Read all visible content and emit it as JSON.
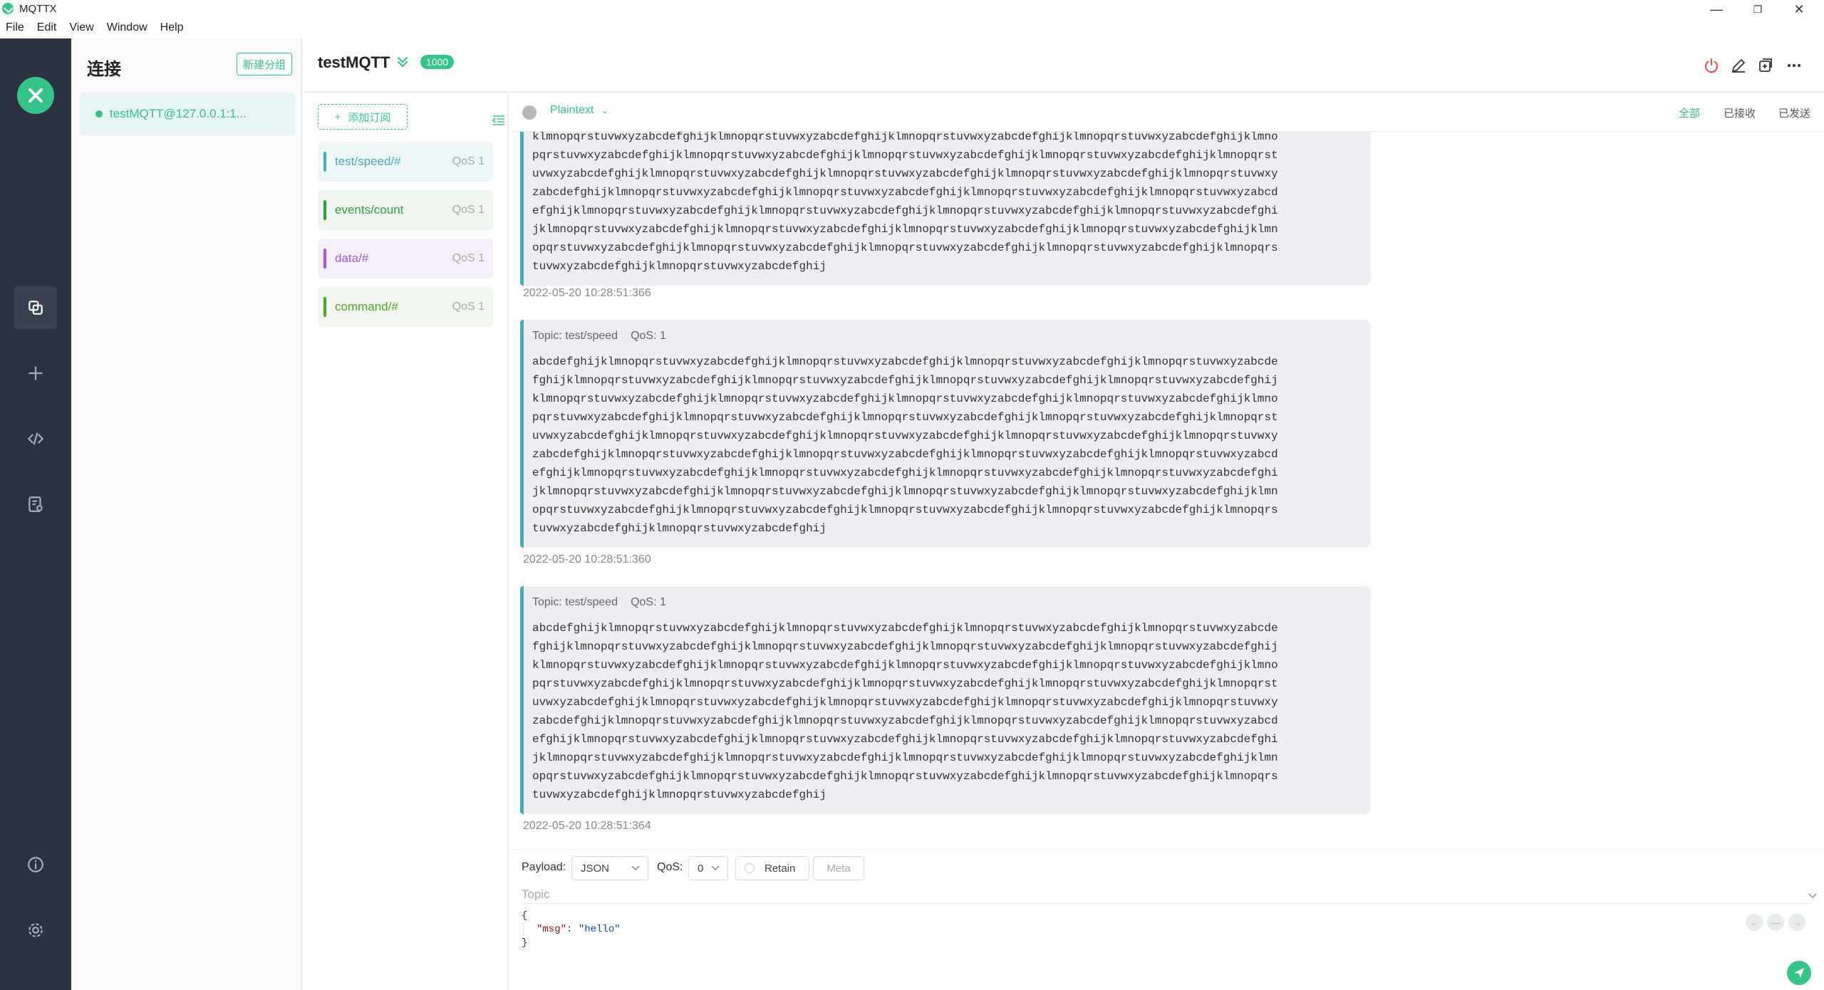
{
  "window": {
    "title": "MQTTX",
    "menu": [
      "File",
      "Edit",
      "View",
      "Window",
      "Help"
    ]
  },
  "connections": {
    "title": "连接",
    "new_group_label": "新建分组",
    "items": [
      {
        "name": "testMQTT@127.0.0.1:1...",
        "status": "connected"
      }
    ]
  },
  "header": {
    "title": "testMQTT",
    "badge": "1000"
  },
  "subscriptions": {
    "add_label": "添加订阅",
    "items": [
      {
        "topic": "test/speed/#",
        "qos": "QoS 1",
        "color": "#49a9b8",
        "bg": "#eef7f8"
      },
      {
        "topic": "events/count",
        "qos": "QoS 1",
        "color": "#2ea33d",
        "bg": "#eef6ef"
      },
      {
        "topic": "data/#",
        "qos": "QoS 1",
        "color": "#a45ad6",
        "bg": "#f5eff9"
      },
      {
        "topic": "command/#",
        "qos": "QoS 1",
        "color": "#52a62a",
        "bg": "#f1f6ee"
      }
    ]
  },
  "message_toolbar": {
    "format": "Plaintext",
    "filters": [
      "全部",
      "已接收",
      "已发送"
    ],
    "active_filter": "全部"
  },
  "messages": [
    {
      "topic": "",
      "qos": "",
      "lines": [
        "klmnopqrstuvwxyzabcdefghijklmnopqrstuvwxyzabcdefghijklmnopqrstuvwxyzabcdefghijklmnopqrstuvwxyzabcdefghijklmno",
        "pqrstuvwxyzabcdefghijklmnopqrstuvwxyzabcdefghijklmnopqrstuvwxyzabcdefghijklmnopqrstuvwxyzabcdefghijklmnopqrst",
        "uvwxyzabcdefghijklmnopqrstuvwxyzabcdefghijklmnopqrstuvwxyzabcdefghijklmnopqrstuvwxyzabcdefghijklmnopqrstuvwxy",
        "zabcdefghijklmnopqrstuvwxyzabcdefghijklmnopqrstuvwxyzabcdefghijklmnopqrstuvwxyzabcdefghijklmnopqrstuvwxyzabcd",
        "efghijklmnopqrstuvwxyzabcdefghijklmnopqrstuvwxyzabcdefghijklmnopqrstuvwxyzabcdefghijklmnopqrstuvwxyzabcdefghi",
        "jklmnopqrstuvwxyzabcdefghijklmnopqrstuvwxyzabcdefghijklmnopqrstuvwxyzabcdefghijklmnopqrstuvwxyzabcdefghijklmn",
        "opqrstuvwxyzabcdefghijklmnopqrstuvwxyzabcdefghijklmnopqrstuvwxyzabcdefghijklmnopqrstuvwxyzabcdefghijklmnopqrs",
        "tuvwxyzabcdefghijklmnopqrstuvwxyzabcdefghij"
      ],
      "time": "2022-05-20 10:28:51:366"
    },
    {
      "topic": "Topic: test/speed",
      "qos": "QoS: 1",
      "lines": [
        "abcdefghijklmnopqrstuvwxyzabcdefghijklmnopqrstuvwxyzabcdefghijklmnopqrstuvwxyzabcdefghijklmnopqrstuvwxyzabcde",
        "fghijklmnopqrstuvwxyzabcdefghijklmnopqrstuvwxyzabcdefghijklmnopqrstuvwxyzabcdefghijklmnopqrstuvwxyzabcdefghij",
        "klmnopqrstuvwxyzabcdefghijklmnopqrstuvwxyzabcdefghijklmnopqrstuvwxyzabcdefghijklmnopqrstuvwxyzabcdefghijklmno",
        "pqrstuvwxyzabcdefghijklmnopqrstuvwxyzabcdefghijklmnopqrstuvwxyzabcdefghijklmnopqrstuvwxyzabcdefghijklmnopqrst",
        "uvwxyzabcdefghijklmnopqrstuvwxyzabcdefghijklmnopqrstuvwxyzabcdefghijklmnopqrstuvwxyzabcdefghijklmnopqrstuvwxy",
        "zabcdefghijklmnopqrstuvwxyzabcdefghijklmnopqrstuvwxyzabcdefghijklmnopqrstuvwxyzabcdefghijklmnopqrstuvwxyzabcd",
        "efghijklmnopqrstuvwxyzabcdefghijklmnopqrstuvwxyzabcdefghijklmnopqrstuvwxyzabcdefghijklmnopqrstuvwxyzabcdefghi",
        "jklmnopqrstuvwxyzabcdefghijklmnopqrstuvwxyzabcdefghijklmnopqrstuvwxyzabcdefghijklmnopqrstuvwxyzabcdefghijklmn",
        "opqrstuvwxyzabcdefghijklmnopqrstuvwxyzabcdefghijklmnopqrstuvwxyzabcdefghijklmnopqrstuvwxyzabcdefghijklmnopqrs",
        "tuvwxyzabcdefghijklmnopqrstuvwxyzabcdefghij"
      ],
      "time": "2022-05-20 10:28:51:360"
    },
    {
      "topic": "Topic: test/speed",
      "qos": "QoS: 1",
      "lines": [
        "abcdefghijklmnopqrstuvwxyzabcdefghijklmnopqrstuvwxyzabcdefghijklmnopqrstuvwxyzabcdefghijklmnopqrstuvwxyzabcde",
        "fghijklmnopqrstuvwxyzabcdefghijklmnopqrstuvwxyzabcdefghijklmnopqrstuvwxyzabcdefghijklmnopqrstuvwxyzabcdefghij",
        "klmnopqrstuvwxyzabcdefghijklmnopqrstuvwxyzabcdefghijklmnopqrstuvwxyzabcdefghijklmnopqrstuvwxyzabcdefghijklmno",
        "pqrstuvwxyzabcdefghijklmnopqrstuvwxyzabcdefghijklmnopqrstuvwxyzabcdefghijklmnopqrstuvwxyzabcdefghijklmnopqrst",
        "uvwxyzabcdefghijklmnopqrstuvwxyzabcdefghijklmnopqrstuvwxyzabcdefghijklmnopqrstuvwxyzabcdefghijklmnopqrstuvwxy",
        "zabcdefghijklmnopqrstuvwxyzabcdefghijklmnopqrstuvwxyzabcdefghijklmnopqrstuvwxyzabcdefghijklmnopqrstuvwxyzabcd",
        "efghijklmnopqrstuvwxyzabcdefghijklmnopqrstuvwxyzabcdefghijklmnopqrstuvwxyzabcdefghijklmnopqrstuvwxyzabcdefghi",
        "jklmnopqrstuvwxyzabcdefghijklmnopqrstuvwxyzabcdefghijklmnopqrstuvwxyzabcdefghijklmnopqrstuvwxyzabcdefghijklmn",
        "opqrstuvwxyzabcdefghijklmnopqrstuvwxyzabcdefghijklmnopqrstuvwxyzabcdefghijklmnopqrstuvwxyzabcdefghijklmnopqrs",
        "tuvwxyzabcdefghijklmnopqrstuvwxyzabcdefghij"
      ],
      "time": "2022-05-20 10:28:51:364"
    }
  ],
  "publish": {
    "payload_label": "Payload:",
    "payload_format": "JSON",
    "qos_label": "QoS:",
    "qos_value": "0",
    "retain_label": "Retain",
    "meta_label": "Meta",
    "topic_placeholder": "Topic",
    "payload_text": {
      "open": "{",
      "key": "\"msg\"",
      "colon": ": ",
      "value": "\"hello\"",
      "close": "}"
    }
  },
  "colors": {
    "accent": "#34c388",
    "rail": "#2c3240",
    "disconnect": "#e84a4a"
  }
}
